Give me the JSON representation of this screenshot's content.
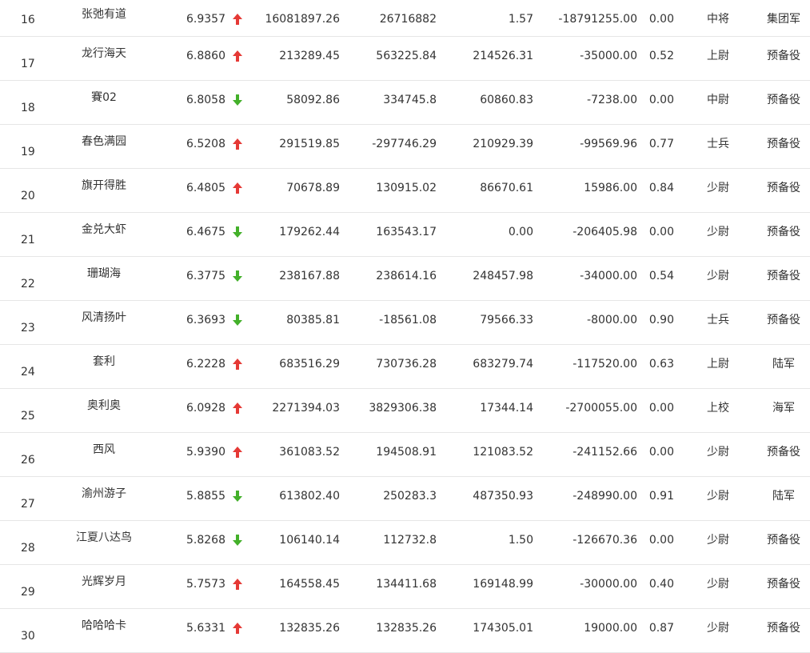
{
  "colors": {
    "up": "#e53935",
    "down": "#43b02a",
    "text": "#333333",
    "row_border": "#e6e6e6"
  },
  "rows": [
    {
      "rank": "16",
      "name": "张弛有道",
      "score": "6.9357",
      "trend": "up",
      "v1": "16081897.26",
      "v2": "26716882",
      "v3": "1.57",
      "v4": "-18791255.00",
      "v5": "0.00",
      "title": "中将",
      "unit": "集团军"
    },
    {
      "rank": "17",
      "name": "龙行海天",
      "score": "6.8860",
      "trend": "up",
      "v1": "213289.45",
      "v2": "563225.84",
      "v3": "214526.31",
      "v4": "-35000.00",
      "v5": "0.52",
      "title": "上尉",
      "unit": "预备役"
    },
    {
      "rank": "18",
      "name": "賽02",
      "score": "6.8058",
      "trend": "down",
      "v1": "58092.86",
      "v2": "334745.8",
      "v3": "60860.83",
      "v4": "-7238.00",
      "v5": "0.00",
      "title": "中尉",
      "unit": "预备役"
    },
    {
      "rank": "19",
      "name": "春色满园",
      "score": "6.5208",
      "trend": "up",
      "v1": "291519.85",
      "v2": "-297746.29",
      "v3": "210929.39",
      "v4": "-99569.96",
      "v5": "0.77",
      "title": "士兵",
      "unit": "预备役"
    },
    {
      "rank": "20",
      "name": "旗开得胜",
      "score": "6.4805",
      "trend": "up",
      "v1": "70678.89",
      "v2": "130915.02",
      "v3": "86670.61",
      "v4": "15986.00",
      "v5": "0.84",
      "title": "少尉",
      "unit": "预备役"
    },
    {
      "rank": "21",
      "name": "金兑大虾",
      "score": "6.4675",
      "trend": "down",
      "v1": "179262.44",
      "v2": "163543.17",
      "v3": "0.00",
      "v4": "-206405.98",
      "v5": "0.00",
      "title": "少尉",
      "unit": "预备役"
    },
    {
      "rank": "22",
      "name": "珊瑚海",
      "score": "6.3775",
      "trend": "down",
      "v1": "238167.88",
      "v2": "238614.16",
      "v3": "248457.98",
      "v4": "-34000.00",
      "v5": "0.54",
      "title": "少尉",
      "unit": "预备役"
    },
    {
      "rank": "23",
      "name": "风清扬叶",
      "score": "6.3693",
      "trend": "down",
      "v1": "80385.81",
      "v2": "-18561.08",
      "v3": "79566.33",
      "v4": "-8000.00",
      "v5": "0.90",
      "title": "士兵",
      "unit": "预备役"
    },
    {
      "rank": "24",
      "name": "套利",
      "score": "6.2228",
      "trend": "up",
      "v1": "683516.29",
      "v2": "730736.28",
      "v3": "683279.74",
      "v4": "-117520.00",
      "v5": "0.63",
      "title": "上尉",
      "unit": "陆军"
    },
    {
      "rank": "25",
      "name": "奥利奥",
      "score": "6.0928",
      "trend": "up",
      "v1": "2271394.03",
      "v2": "3829306.38",
      "v3": "17344.14",
      "v4": "-2700055.00",
      "v5": "0.00",
      "title": "上校",
      "unit": "海军"
    },
    {
      "rank": "26",
      "name": "西风",
      "score": "5.9390",
      "trend": "up",
      "v1": "361083.52",
      "v2": "194508.91",
      "v3": "121083.52",
      "v4": "-241152.66",
      "v5": "0.00",
      "title": "少尉",
      "unit": "预备役"
    },
    {
      "rank": "27",
      "name": "渝州游子",
      "score": "5.8855",
      "trend": "down",
      "v1": "613802.40",
      "v2": "250283.3",
      "v3": "487350.93",
      "v4": "-248990.00",
      "v5": "0.91",
      "title": "少尉",
      "unit": "陆军"
    },
    {
      "rank": "28",
      "name": "江夏八达鸟",
      "score": "5.8268",
      "trend": "down",
      "v1": "106140.14",
      "v2": "112732.8",
      "v3": "1.50",
      "v4": "-126670.36",
      "v5": "0.00",
      "title": "少尉",
      "unit": "预备役"
    },
    {
      "rank": "29",
      "name": "光辉岁月",
      "score": "5.7573",
      "trend": "up",
      "v1": "164558.45",
      "v2": "134411.68",
      "v3": "169148.99",
      "v4": "-30000.00",
      "v5": "0.40",
      "title": "少尉",
      "unit": "预备役"
    },
    {
      "rank": "30",
      "name": "哈哈哈卡",
      "score": "5.6331",
      "trend": "up",
      "v1": "132835.26",
      "v2": "132835.26",
      "v3": "174305.01",
      "v4": "19000.00",
      "v5": "0.87",
      "title": "少尉",
      "unit": "预备役"
    }
  ]
}
